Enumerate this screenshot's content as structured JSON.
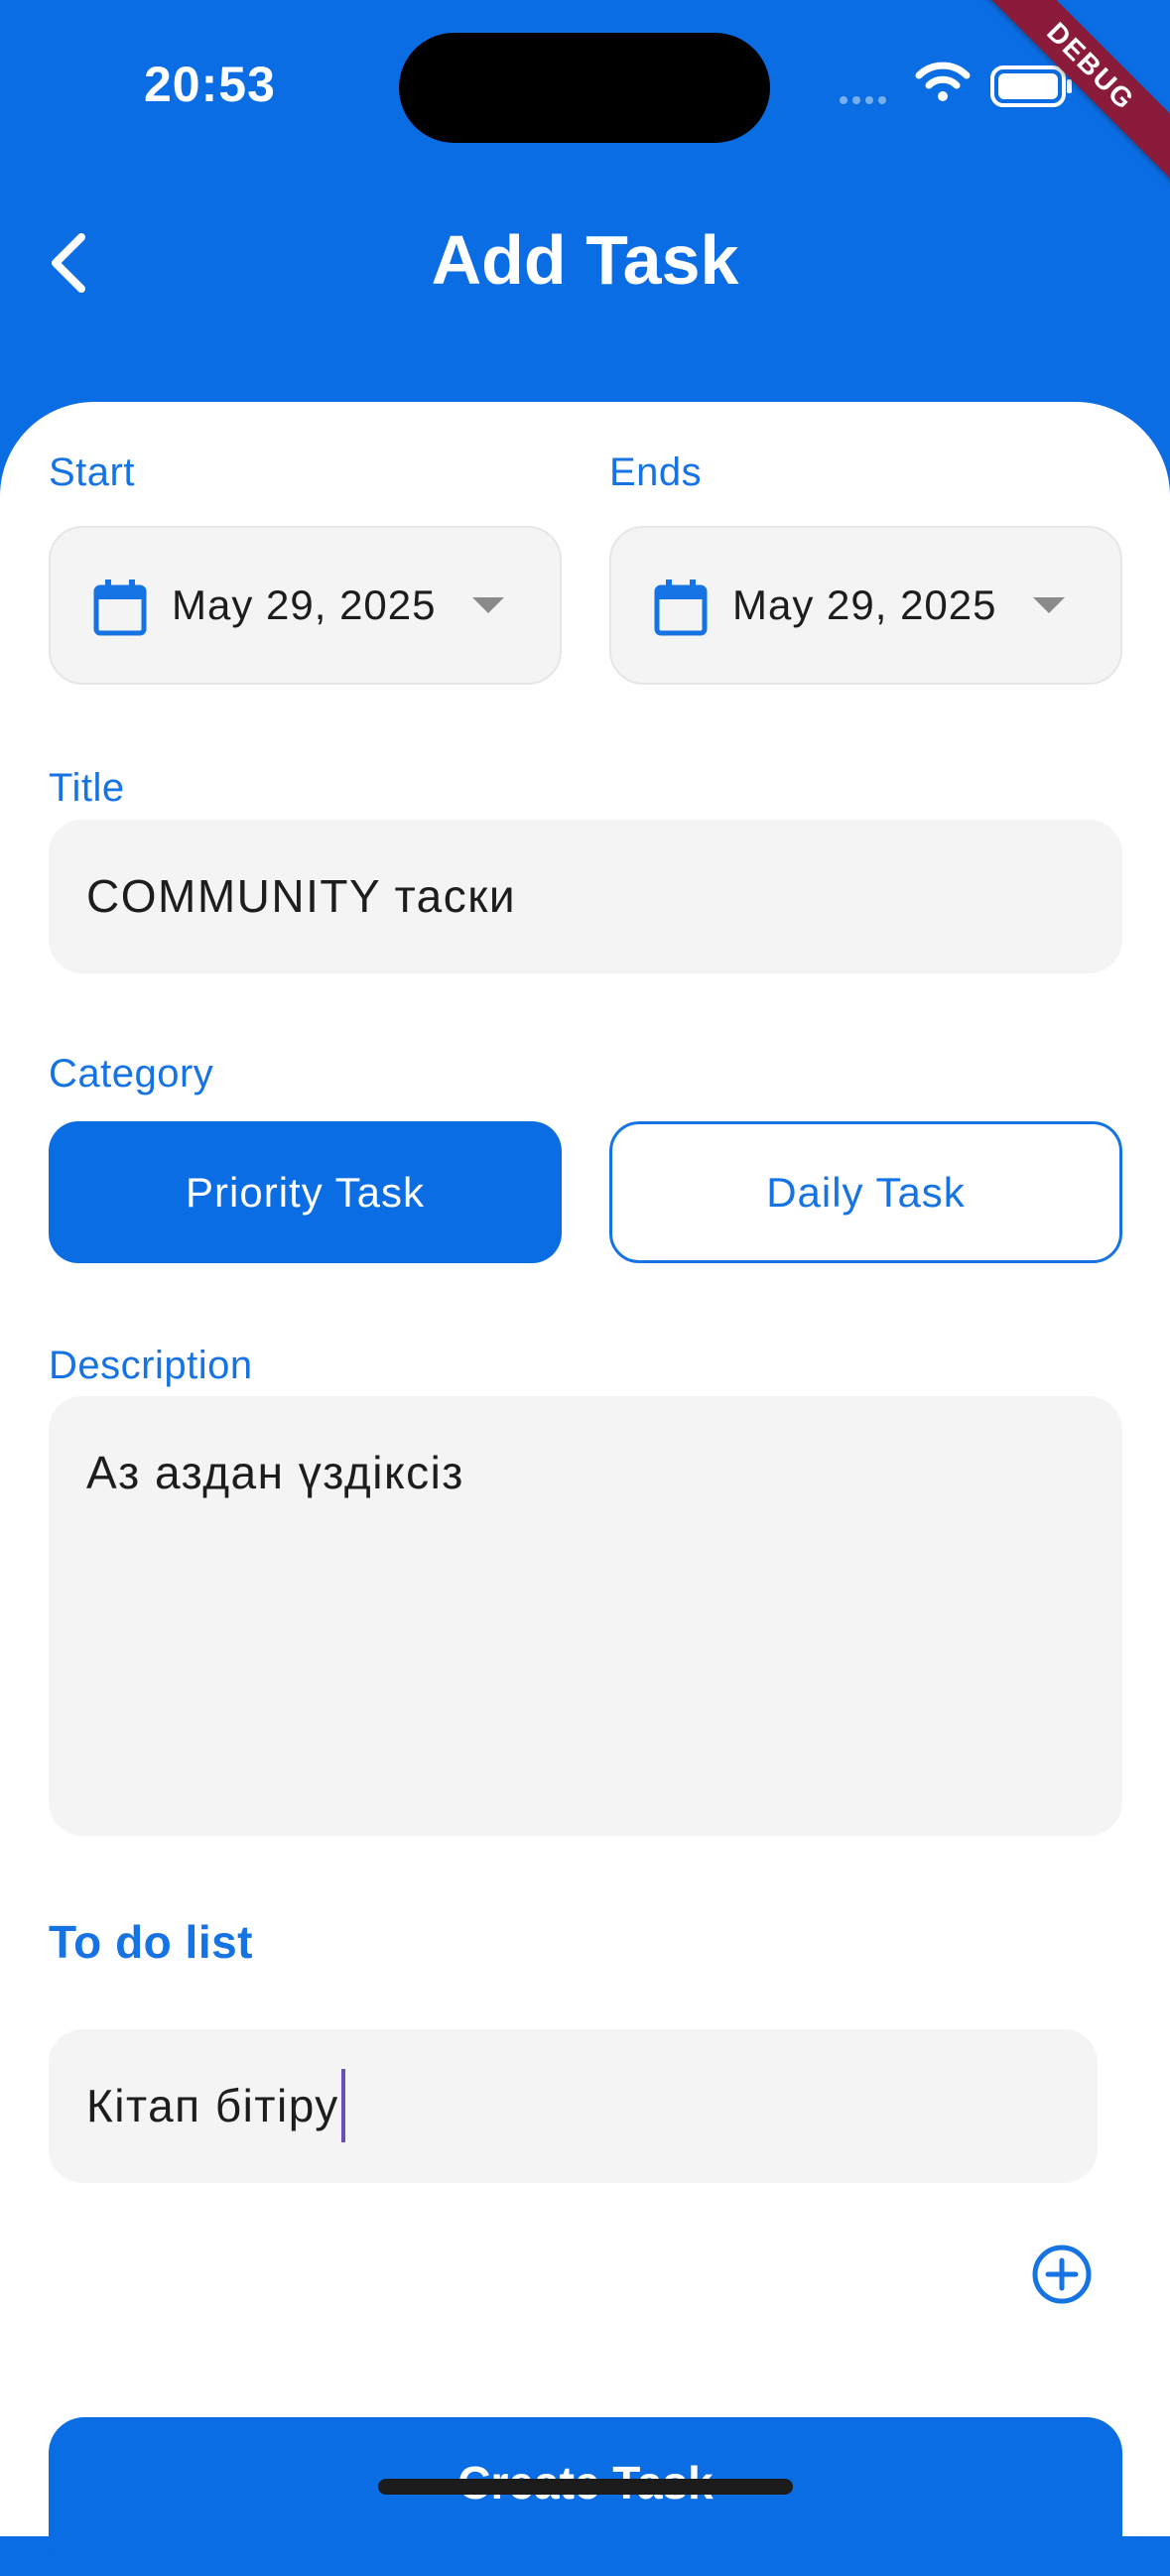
{
  "status_bar": {
    "time": "20:53",
    "debug_banner": "DEBUG"
  },
  "header": {
    "title": "Add Task",
    "back_icon": "chevron-left-icon"
  },
  "dates": {
    "start_label": "Start",
    "start_value": "May 29, 2025",
    "end_label": "Ends",
    "end_value": "May 29, 2025"
  },
  "title_field": {
    "label": "Title",
    "value": "COMMUNITY таски"
  },
  "category": {
    "label": "Category",
    "options": [
      "Priority Task",
      "Daily Task"
    ],
    "selected": "Priority Task"
  },
  "description": {
    "label": "Description",
    "value": "Аз аздан үздіксіз"
  },
  "todo": {
    "label": "To do list",
    "item_value": "Кітап бітіру",
    "add_icon": "plus-circle-icon"
  },
  "actions": {
    "create_label": "Create Task"
  },
  "colors": {
    "primary": "#0b6de3",
    "field_bg": "#f4f4f4",
    "label": "#1673e3"
  }
}
